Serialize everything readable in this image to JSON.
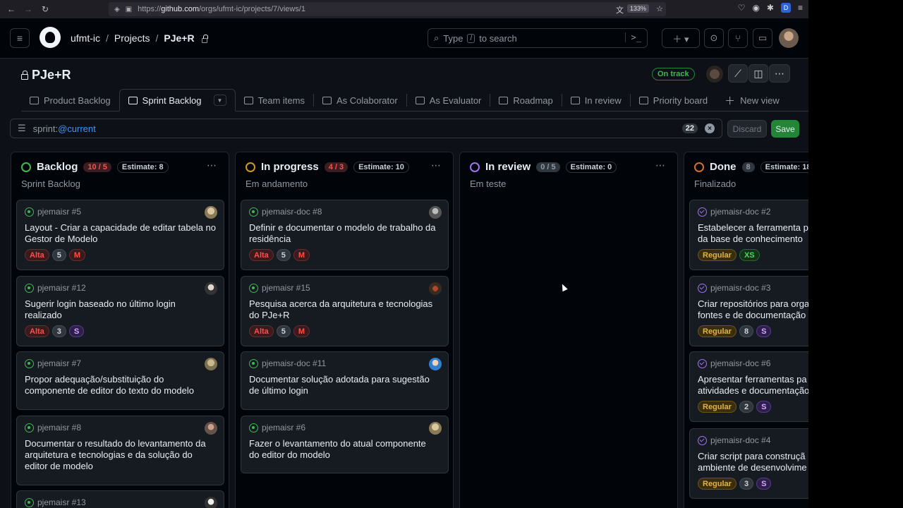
{
  "browser": {
    "url_prefix": "https://",
    "url_domain": "github.com",
    "url_path": "/orgs/ufmt-ic/projects/7/views/1",
    "zoom": "133%"
  },
  "header": {
    "org": "ufmt-ic",
    "projects": "Projects",
    "project": "PJe+R",
    "search_prefix": "Type",
    "search_key": "/",
    "search_suffix": "to search"
  },
  "project": {
    "title": "PJe+R",
    "status": "On track"
  },
  "tabs": [
    {
      "label": "Product Backlog"
    },
    {
      "label": "Sprint Backlog"
    },
    {
      "label": "Team items"
    },
    {
      "label": "As Colaborator"
    },
    {
      "label": "As Evaluator"
    },
    {
      "label": "Roadmap"
    },
    {
      "label": "In review"
    },
    {
      "label": "Priority board"
    },
    {
      "label": "New view"
    }
  ],
  "filter": {
    "prefix": "sprint:",
    "value": "@current",
    "count": "22",
    "discard": "Discard",
    "save": "Save"
  },
  "columns": [
    {
      "name": "Backlog",
      "count": "10 / 5",
      "estimate": "Estimate: 8",
      "description": "Sprint Backlog",
      "status_color": "#3fb950",
      "cards": [
        {
          "ref": "pjemaisr #5",
          "title": "Layout - Criar a capacidade de editar tabela no\nGestor de Modelo",
          "labels": [
            "Alta",
            "5",
            "M"
          ]
        },
        {
          "ref": "pjemaisr #12",
          "title": "Sugerir login baseado no último login\nrealizado",
          "labels": [
            "Alta",
            "3",
            "S"
          ]
        },
        {
          "ref": "pjemaisr #7",
          "title": "Propor adequação/substituição do\ncomponente de editor do texto do modelo",
          "labels": []
        },
        {
          "ref": "pjemaisr #8",
          "title": "Documentar o resultado do levantamento da\narquitetura e tecnologias e da solução do\neditor de modelo",
          "labels": []
        },
        {
          "ref": "pjemaisr #13",
          "title": "",
          "labels": []
        }
      ]
    },
    {
      "name": "In progress",
      "count": "4 / 3",
      "estimate": "Estimate: 10",
      "description": "Em andamento",
      "status_color": "#d29922",
      "cards": [
        {
          "ref": "pjemaisr-doc #8",
          "title": "Definir e documentar o modelo de trabalho da\nresidência",
          "labels": [
            "Alta",
            "5",
            "M"
          ]
        },
        {
          "ref": "pjemaisr #15",
          "title": "Pesquisa acerca da arquitetura e tecnologias\ndo PJe+R",
          "labels": [
            "Alta",
            "5",
            "M"
          ]
        },
        {
          "ref": "pjemaisr-doc #11",
          "title": "Documentar solução adotada para sugestão\nde último login",
          "labels": []
        },
        {
          "ref": "pjemaisr #6",
          "title": "Fazer o levantamento do atual componente\ndo editor do modelo",
          "labels": []
        }
      ]
    },
    {
      "name": "In review",
      "count": "0 / 5",
      "estimate": "Estimate: 0",
      "description": "Em teste",
      "status_color": "#a371f7",
      "cards": []
    },
    {
      "name": "Done",
      "count": "8",
      "estimate": "Estimate: 18",
      "description": "Finalizado",
      "status_color": "#db6d28",
      "cards": [
        {
          "ref": "pjemaisr-doc #2",
          "title": "Estabelecer a ferramenta p\nda base de conhecimento",
          "labels": [
            "Regular",
            "XS"
          ]
        },
        {
          "ref": "pjemaisr-doc #3",
          "title": "Criar repositórios para orga\nfontes e de documentação",
          "labels": [
            "Regular",
            "8",
            "S"
          ]
        },
        {
          "ref": "pjemaisr-doc #6",
          "title": "Apresentar ferramentas pa\natividades e documentação",
          "labels": [
            "Regular",
            "2",
            "S"
          ]
        },
        {
          "ref": "pjemaisr-doc #4",
          "title": "Criar script para construçã\nambiente de desenvolvime",
          "labels": [
            "Regular",
            "3",
            "S"
          ]
        }
      ]
    }
  ]
}
